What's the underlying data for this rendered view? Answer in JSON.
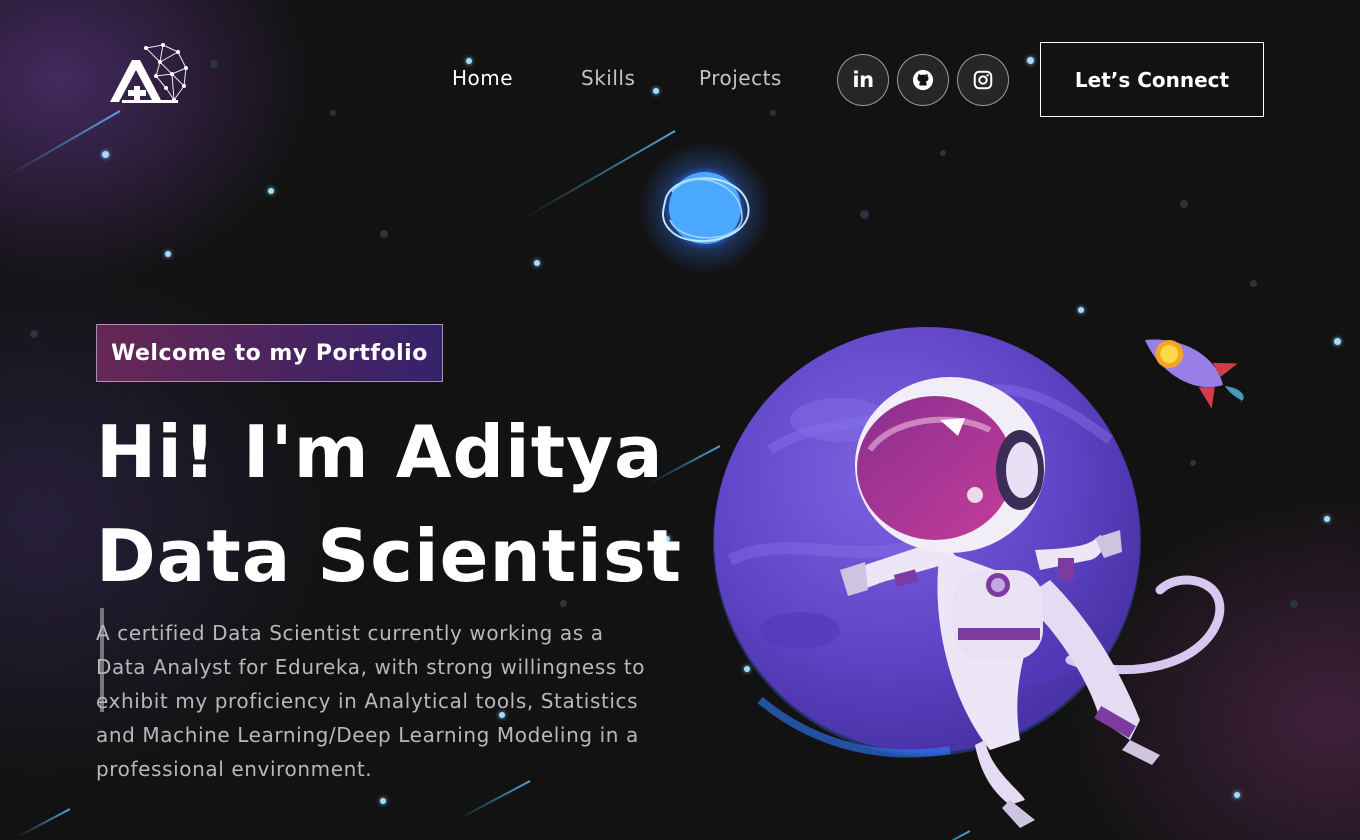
{
  "nav": {
    "links": [
      {
        "label": "Home",
        "active": true
      },
      {
        "label": "Skills",
        "active": false
      },
      {
        "label": "Projects",
        "active": false
      }
    ],
    "social": [
      {
        "name": "linkedin",
        "icon": "linkedin-icon",
        "text": "in"
      },
      {
        "name": "github",
        "icon": "github-icon"
      },
      {
        "name": "instagram",
        "icon": "instagram-icon"
      }
    ],
    "connect_label": "Let’s Connect"
  },
  "hero": {
    "tagline": "Welcome to my Portfolio",
    "title_line1": "Hi! I'm Aditya",
    "title_line2": "Data Scientist",
    "description": "A certified Data Scientist currently working as a Data Analyst for Edureka, with strong willingness to exhibit my proficiency in Analytical tools, Statistics and Machine Learning/Deep Learning Modeling in a professional environment."
  },
  "colors": {
    "background": "#121212",
    "tagline_gradient_start": "#AA367C",
    "tagline_gradient_end": "#4A2FBD",
    "planet": "#6a4fd0",
    "star": "#9fdcff"
  }
}
